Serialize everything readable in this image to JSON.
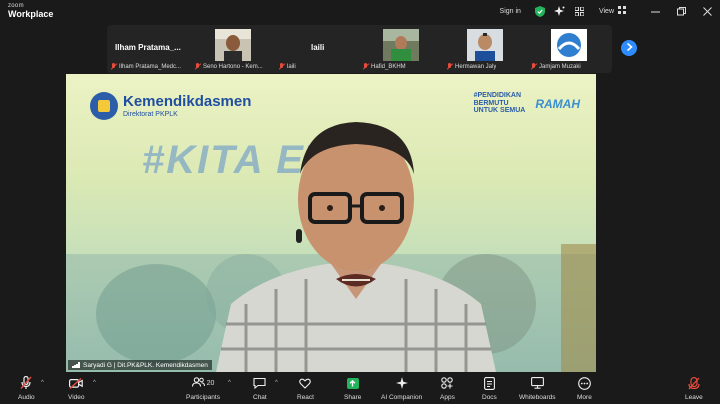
{
  "app": {
    "logo_line1": "zoom",
    "logo_line2": "Workplace"
  },
  "titlebar": {
    "signin": "Sign in",
    "view": "View",
    "icons": [
      "shield-check-icon",
      "sparkle-icon",
      "grid-icon"
    ],
    "window_controls": [
      "minimize-icon",
      "restore-icon",
      "close-icon"
    ]
  },
  "strip": {
    "tiles": [
      {
        "display": "Ilham  Pratama_...",
        "label": "Ilham Pratama_Medc...",
        "muted": true
      },
      {
        "label": "Seno Hartono - Kem...",
        "muted": true
      },
      {
        "display": "laili",
        "label": "laili",
        "muted": true
      },
      {
        "label": "Hafid_BKHM",
        "muted": true
      },
      {
        "label": "Hermawan Jaly",
        "muted": true
      },
      {
        "label": "Jamjam Muzaki",
        "muted": true
      }
    ]
  },
  "video": {
    "brand_title": "Kemendikdasmen",
    "brand_subtitle": "Direktorat PKPLK",
    "tagline": "#KITA     EWA",
    "hash_logo_line1": "#PENDIDIKAN",
    "hash_logo_line2": "BERMUTU",
    "hash_logo_line3": "UNTUK SEMUA",
    "ramah": "RAMAH",
    "speaker_label": "Saryadi G | Dit.PK&PLK. Kemendikdasmen"
  },
  "toolbar": {
    "audio": "Audio",
    "video": "Video",
    "participants": "Participants",
    "participant_count": "20",
    "chat": "Chat",
    "react": "React",
    "share": "Share",
    "ai": "AI Companion",
    "apps": "Apps",
    "docs": "Docs",
    "whiteboards": "Whiteboards",
    "more": "More",
    "leave": "Leave"
  },
  "colors": {
    "accent": "#2d8cff",
    "muted_red": "#e74c3c",
    "share_green": "#22b35c",
    "brand_blue": "#1f4fa0"
  }
}
